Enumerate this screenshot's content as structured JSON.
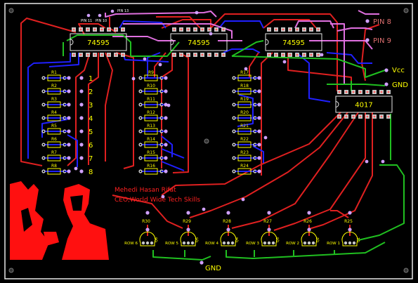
{
  "board": {
    "colors": {
      "background": "#000000",
      "outline": "#e8e8e8",
      "top_trace": "#e02020",
      "bottom_trace": "#2020ff",
      "pink_trace": "#e070e0",
      "green_trace": "#20c020",
      "silk": "#ffff00",
      "pad": "#c8c8c8",
      "drill": "#d0a0ff",
      "photo": "#ff1010"
    }
  },
  "chips": [
    {
      "label": "74595"
    },
    {
      "label": "74595"
    },
    {
      "label": "74595"
    },
    {
      "label": "4017"
    }
  ],
  "header_pins": {
    "pin11": "PIN 11",
    "pin10": "PIN 10",
    "pin13": "PIN 13"
  },
  "ext_labels": {
    "pin8": "PIN 8",
    "pin9": "PIN 9",
    "vcc": "Vcc",
    "gnd_top": "GND",
    "gnd_bottom": "GND"
  },
  "resistors": {
    "col1": [
      "R1",
      "R2",
      "R3",
      "R4",
      "R5",
      "R6",
      "R7",
      "R8"
    ],
    "col2": [
      "R9",
      "R10",
      "R11",
      "R12",
      "R13",
      "R14",
      "R15",
      "R16"
    ],
    "col3": [
      "R17",
      "R18",
      "R19",
      "R20",
      "R21",
      "R22",
      "R23",
      "R24"
    ]
  },
  "column_numbers": [
    "1",
    "2",
    "3",
    "4",
    "5",
    "6",
    "7",
    "8"
  ],
  "credit": {
    "name": "Mehedi Hasan Rifat",
    "title": "CEO,World Wide Tech Skills"
  },
  "row_transistors": [
    {
      "resistor": "R30",
      "label": "ROW 6",
      "q": "Q6"
    },
    {
      "resistor": "R29",
      "label": "ROW 5",
      "q": "Q5"
    },
    {
      "resistor": "R28",
      "label": "ROW 4",
      "q": "Q4"
    },
    {
      "resistor": "R27",
      "label": "ROW 3",
      "q": "Q3"
    },
    {
      "resistor": "R26",
      "label": "ROW 2",
      "q": "Q2"
    },
    {
      "resistor": "R25",
      "label": "ROW 1",
      "q": "Q1"
    }
  ]
}
